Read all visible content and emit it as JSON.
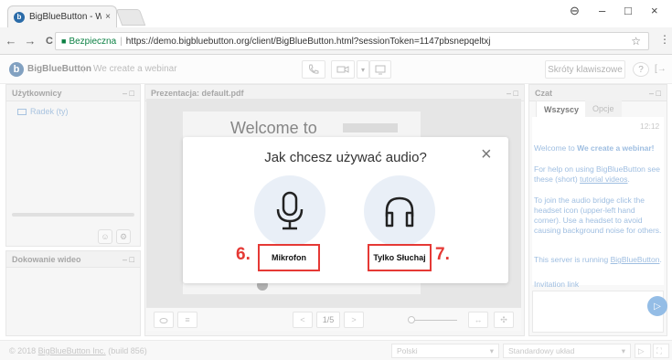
{
  "browser": {
    "tab_title": "BigBlueButton - We creat",
    "tab_close": "×",
    "win_user": "⊖",
    "win_minimize": "–",
    "win_maximize": "□",
    "win_close": "×",
    "back": "←",
    "forward": "→",
    "reload": "C",
    "secure_label": "Bezpieczna",
    "url": "https://demo.bigbluebutton.org/client/BigBlueButton.html?sessionToken=1147pbsnepqeltxj",
    "star": "☆",
    "menu": "⋮"
  },
  "header": {
    "logo_letter": "b",
    "app_name": "BigBlueButton",
    "divider": "|",
    "meeting_name": "We create a webinar",
    "shortcuts_label": "Skróty klawiszowe",
    "help_label": "?",
    "logout_label": "[→"
  },
  "users_panel": {
    "title": "Użytkownicy",
    "controls": "– □",
    "user": "Radek (ty)",
    "btn_a": "☺",
    "btn_b": "⚙"
  },
  "webcams_panel": {
    "title": "Dokowanie wideo",
    "controls": "– □"
  },
  "presentation_panel": {
    "title": "Prezentacja: default.pdf",
    "controls": "– □",
    "slide_text": "Welcome to",
    "page_indicator": "1/5",
    "prev": "<",
    "next": ">",
    "fit": "↔",
    "move": "✣"
  },
  "chat_panel": {
    "title": "Czat",
    "controls": "– □",
    "tab_all": "Wszyscy",
    "tab_options": "Opcje",
    "time": "12:12",
    "msg_welcome_prefix": "Welcome to ",
    "msg_welcome_bold": "We create a webinar!",
    "msg_help_prefix": "For help on using BigBlueButton see these (short) ",
    "msg_help_link": "tutorial videos",
    "msg_help_suffix": ".",
    "msg_audio": "To join the audio bridge click the headset icon (upper-left hand corner).  Use a headset to avoid causing background noise for others.",
    "msg_running_prefix": "This server is running ",
    "msg_running_link": "BigBlueButton",
    "msg_running_suffix": ".",
    "msg_invite": "Invitation link",
    "send": "▷"
  },
  "footer": {
    "copyright_prefix": "© 2018 ",
    "copyright_link": "BigBlueButton Inc.",
    "copyright_suffix": " (build 856)",
    "language": "Polski",
    "layout": "Standardowy układ",
    "dropdown_arrow": "▾"
  },
  "modal": {
    "title": "Jak chcesz używać audio?",
    "close": "×",
    "mic_label": "Mikrofon",
    "listen_label": "Tylko Słuchaj",
    "step_mic": "6.",
    "step_listen": "7."
  },
  "colors": {
    "accent": "#5b9ad9",
    "annotation": "#e53935",
    "secure": "#0b8043"
  }
}
